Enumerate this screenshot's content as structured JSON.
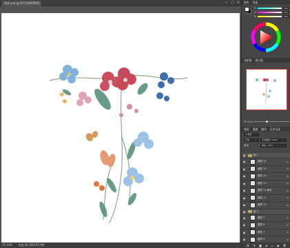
{
  "document": {
    "tab_title": "花朵.psd @ 25.1%(RGB/8)",
    "window_buttons": [
      "—",
      "□",
      "✕"
    ]
  },
  "status": {
    "zoom": "25.14%",
    "doc_info": "文档:44.2M/105.0M"
  },
  "color_panel": {
    "tabs": [
      "颜色",
      "色板"
    ],
    "foreground": "#ffffff",
    "background": "#000000",
    "sliders": [
      {
        "label": "R",
        "value": "255"
      },
      {
        "label": "G",
        "value": "255"
      },
      {
        "label": "B",
        "value": "255"
      }
    ]
  },
  "navigator": {
    "tabs": [
      "导航器",
      "直方图"
    ],
    "zoom_value": "25.14%"
  },
  "layers_panel": {
    "tabs": [
      "图层",
      "通道",
      "路径",
      "历史记录"
    ],
    "filter_label": "Q 类型",
    "blend_mode": "正常",
    "opacity": "不透明度: 100%",
    "lock_label": "锁定:",
    "fill": "填充: 100%",
    "layers": [
      {
        "name": "组 1",
        "type": "group",
        "fx": ""
      },
      {
        "name": "图层 16",
        "type": "layer",
        "fx": "fx"
      },
      {
        "name": "图层 15",
        "type": "layer",
        "fx": "fx"
      },
      {
        "name": "图层 14",
        "type": "layer",
        "fx": "fx"
      },
      {
        "name": "图层 13",
        "type": "layer",
        "fx": "fx"
      },
      {
        "name": "图层 12 副本",
        "type": "layer",
        "fx": "fx"
      },
      {
        "name": "图层 11",
        "type": "layer",
        "fx": "fx"
      },
      {
        "name": "图层 10",
        "type": "layer",
        "fx": "fx"
      },
      {
        "name": "组 2",
        "type": "group",
        "fx": ""
      },
      {
        "name": "图层 9",
        "type": "layer",
        "fx": "fx"
      },
      {
        "name": "图层 8",
        "type": "layer",
        "fx": "fx"
      },
      {
        "name": "图层 7",
        "type": "layer",
        "fx": "fx"
      },
      {
        "name": "图层 6",
        "type": "layer",
        "fx": "fx"
      }
    ],
    "footer_icons": [
      "link-icon",
      "fx-icon",
      "mask-icon",
      "adjustment-icon",
      "folder-icon",
      "new-layer-icon",
      "trash-icon"
    ]
  }
}
